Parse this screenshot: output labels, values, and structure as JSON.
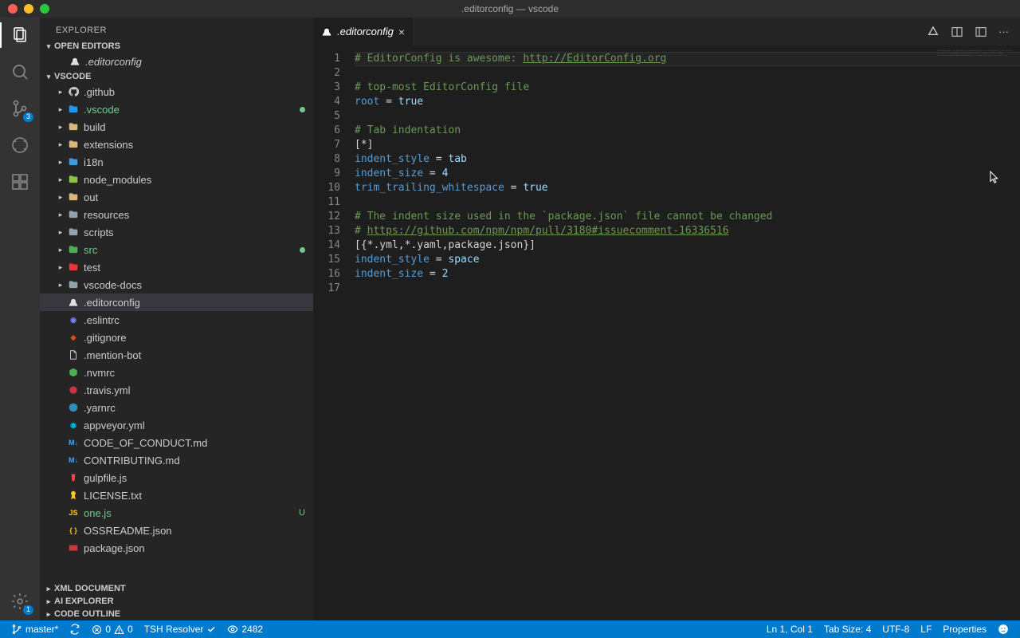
{
  "window": {
    "title": ".editorconfig — vscode"
  },
  "activity": {
    "badges": {
      "scm": "3",
      "settings": "1"
    }
  },
  "sidebar": {
    "title": "EXPLORER",
    "sections": {
      "openEditors": {
        "label": "OPEN EDITORS"
      },
      "workspace": {
        "label": "VSCODE"
      },
      "xml": {
        "label": "XML DOCUMENT"
      },
      "ai": {
        "label": "AI EXPLORER"
      },
      "outline": {
        "label": "CODE OUTLINE"
      }
    },
    "openEditorItems": [
      {
        "label": ".editorconfig"
      }
    ],
    "tree": [
      {
        "label": ".github",
        "kind": "folder",
        "icon": "github"
      },
      {
        "label": ".vscode",
        "kind": "folder",
        "icon": "vscode",
        "decor": "dot",
        "decorColor": "#73c991",
        "labelClass": "green"
      },
      {
        "label": "build",
        "kind": "folder",
        "icon": "folder"
      },
      {
        "label": "extensions",
        "kind": "folder",
        "icon": "folder"
      },
      {
        "label": "i18n",
        "kind": "folder",
        "icon": "i18n"
      },
      {
        "label": "node_modules",
        "kind": "folder",
        "icon": "node"
      },
      {
        "label": "out",
        "kind": "folder",
        "icon": "folder"
      },
      {
        "label": "resources",
        "kind": "folder",
        "icon": "folder-gray"
      },
      {
        "label": "scripts",
        "kind": "folder",
        "icon": "folder-gray"
      },
      {
        "label": "src",
        "kind": "folder",
        "icon": "src",
        "decor": "dot",
        "decorColor": "#73c991",
        "labelClass": "green"
      },
      {
        "label": "test",
        "kind": "folder",
        "icon": "test"
      },
      {
        "label": "vscode-docs",
        "kind": "folder",
        "icon": "folder-gray"
      },
      {
        "label": ".editorconfig",
        "kind": "file",
        "icon": "editorconfig",
        "selected": true
      },
      {
        "label": ".eslintrc",
        "kind": "file",
        "icon": "eslint"
      },
      {
        "label": ".gitignore",
        "kind": "file",
        "icon": "git"
      },
      {
        "label": ".mention-bot",
        "kind": "file",
        "icon": "file"
      },
      {
        "label": ".nvmrc",
        "kind": "file",
        "icon": "nvm"
      },
      {
        "label": ".travis.yml",
        "kind": "file",
        "icon": "travis"
      },
      {
        "label": ".yarnrc",
        "kind": "file",
        "icon": "yarn"
      },
      {
        "label": "appveyor.yml",
        "kind": "file",
        "icon": "appveyor"
      },
      {
        "label": "CODE_OF_CONDUCT.md",
        "kind": "file",
        "icon": "md"
      },
      {
        "label": "CONTRIBUTING.md",
        "kind": "file",
        "icon": "md"
      },
      {
        "label": "gulpfile.js",
        "kind": "file",
        "icon": "gulp"
      },
      {
        "label": "LICENSE.txt",
        "kind": "file",
        "icon": "license"
      },
      {
        "label": "one.js",
        "kind": "file",
        "icon": "js",
        "decor": "U",
        "decorColor": "#73c991",
        "labelClass": "green"
      },
      {
        "label": "OSSREADME.json",
        "kind": "file",
        "icon": "json"
      },
      {
        "label": "package.json",
        "kind": "file",
        "icon": "npm"
      }
    ]
  },
  "tabs": [
    {
      "label": ".editorconfig",
      "active": true
    }
  ],
  "code": {
    "lines": [
      {
        "n": 1,
        "html": "<span class='c-comment'># EditorConfig is awesome: </span><span class='c-link'>http://EditorConfig.org</span>",
        "cursor": true
      },
      {
        "n": 2,
        "html": ""
      },
      {
        "n": 3,
        "html": "<span class='c-comment'># top-most EditorConfig file</span>"
      },
      {
        "n": 4,
        "html": "<span class='c-key'>root</span><span class='c-op'> = </span><span class='c-val'>true</span>"
      },
      {
        "n": 5,
        "html": ""
      },
      {
        "n": 6,
        "html": "<span class='c-comment'># Tab indentation</span>"
      },
      {
        "n": 7,
        "html": "<span class='c-sec'>[*]</span>"
      },
      {
        "n": 8,
        "html": "<span class='c-key'>indent_style</span><span class='c-op'> = </span><span class='c-val'>tab</span>"
      },
      {
        "n": 9,
        "html": "<span class='c-key'>indent_size</span><span class='c-op'> = </span><span class='c-val'>4</span>"
      },
      {
        "n": 10,
        "html": "<span class='c-key'>trim_trailing_whitespace</span><span class='c-op'> = </span><span class='c-val'>true</span>"
      },
      {
        "n": 11,
        "html": ""
      },
      {
        "n": 12,
        "html": "<span class='c-comment'># The indent size used in the `package.json` file cannot be changed</span>"
      },
      {
        "n": 13,
        "html": "<span class='c-comment'># </span><span class='c-link'>https://github.com/npm/npm/pull/3180#issuecomment-16336516</span>"
      },
      {
        "n": 14,
        "html": "<span class='c-sec'>[{*.yml,*.yaml,package.json}]</span>"
      },
      {
        "n": 15,
        "html": "<span class='c-key'>indent_style</span><span class='c-op'> = </span><span class='c-val'>space</span>"
      },
      {
        "n": 16,
        "html": "<span class='c-key'>indent_size</span><span class='c-op'> = </span><span class='c-val'>2</span>"
      },
      {
        "n": 17,
        "html": ""
      }
    ]
  },
  "status": {
    "branch": "master*",
    "errors": "0",
    "warnings": "0",
    "resolver": "TSH Resolver",
    "counter": "2482",
    "lncol": "Ln 1, Col 1",
    "tabsize": "Tab Size: 4",
    "encoding": "UTF-8",
    "eol": "LF",
    "lang": "Properties"
  },
  "iconColors": {
    "github": "#cccccc",
    "vscode": "#2196f3",
    "folder": "#dcb67a",
    "i18n": "#3f9cd6",
    "node": "#8bc34a",
    "folder-gray": "#90a4ae",
    "src": "#4caf50",
    "test": "#e53935",
    "editorconfig": "#e0e0e0",
    "eslint": "#8080f2",
    "git": "#e64a19",
    "file": "#cccccc",
    "nvm": "#4caf50",
    "travis": "#cb3349",
    "yarn": "#2c8ebb",
    "appveyor": "#00b3e0",
    "md": "#42a5f5",
    "gulp": "#eb4a4b",
    "license": "#ffca28",
    "js": "#ffca28",
    "json": "#fbc02d",
    "npm": "#cb3837"
  },
  "iconText": {
    "github": "",
    "vscode": "",
    "folder": "",
    "i18n": "",
    "node": "",
    "folder-gray": "",
    "src": "",
    "test": "",
    "editorconfig": "",
    "eslint": "◉",
    "git": "◆",
    "file": "",
    "nvm": "",
    "travis": "",
    "yarn": "",
    "appveyor": "◉",
    "md": "M↓",
    "gulp": "",
    "license": "",
    "js": "JS",
    "json": "{ }",
    "npm": ""
  }
}
